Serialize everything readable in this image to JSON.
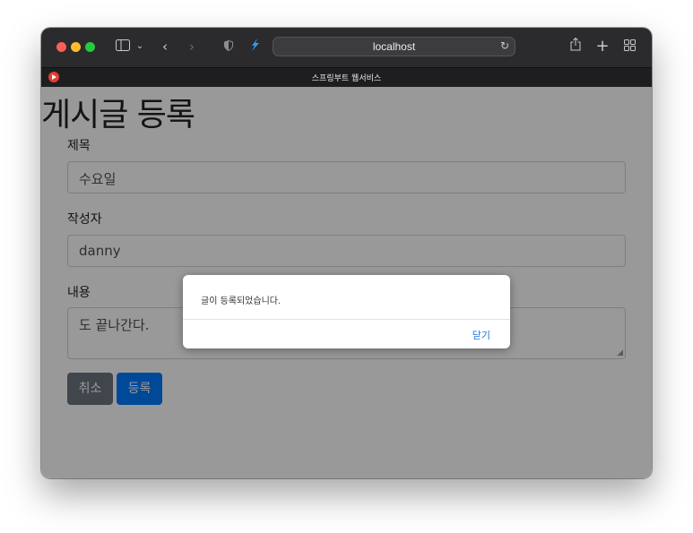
{
  "browser": {
    "url": "localhost",
    "tab_title": "스프링부트 웹서비스",
    "icons": [
      "sidebar-icon",
      "chevron-down-icon",
      "back-icon",
      "forward-icon",
      "shield-icon",
      "extension-icon",
      "reload-icon",
      "share-icon",
      "new-tab-icon",
      "tab-overview-icon"
    ]
  },
  "page": {
    "heading": "게시글 등록",
    "fields": {
      "title_label": "제목",
      "title_value": "수요일",
      "author_label": "작성자",
      "author_value": "danny",
      "content_label": "내용",
      "content_value": "도 끝나간다."
    },
    "buttons": {
      "cancel": "취소",
      "submit": "등록"
    },
    "colors": {
      "cancel": "#6c757d",
      "submit": "#007bff"
    }
  },
  "alert": {
    "message": "글이 등록되었습니다.",
    "close_label": "닫기"
  }
}
